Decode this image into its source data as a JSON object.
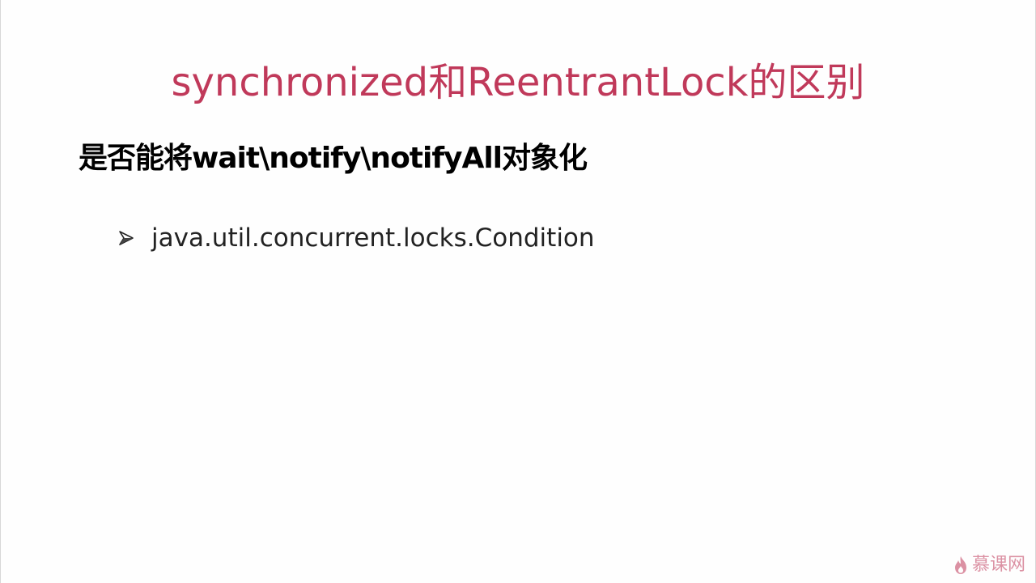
{
  "slide": {
    "title": "synchronized和ReentrantLock的区别",
    "subheading": "是否能将wait\\notify\\notifyAll对象化",
    "bullets": [
      {
        "icon": "arrowhead-bullet-icon",
        "text": "java.util.concurrent.locks.Condition"
      }
    ],
    "watermark": {
      "icon": "flame-logo-icon",
      "text": "慕课网"
    }
  },
  "colors": {
    "title": "#c0395a",
    "subheading": "#000000",
    "bullet_text": "#222222",
    "background": "#fefefe",
    "watermark": "#c0395a"
  }
}
